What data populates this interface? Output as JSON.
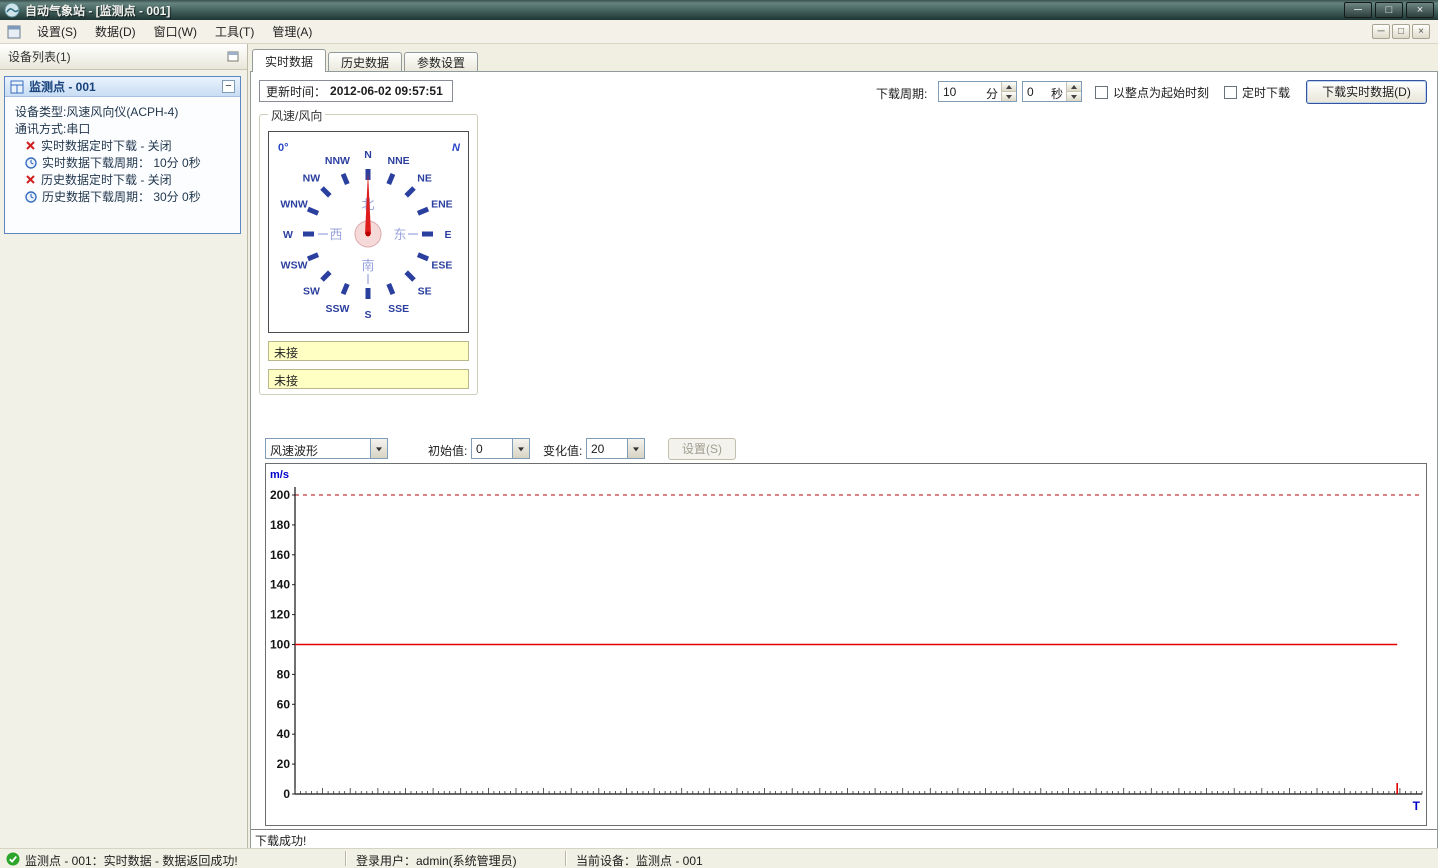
{
  "window": {
    "title": "自动气象站 - [监测点 - 001]",
    "controls": {
      "minimize": "─",
      "maximize": "□",
      "close": "×"
    }
  },
  "menu": {
    "items": [
      "设置(S)",
      "数据(D)",
      "窗口(W)",
      "工具(T)",
      "管理(A)"
    ],
    "mdi_controls": {
      "minimize": "─",
      "restore": "□",
      "close": "×"
    }
  },
  "sidebar": {
    "header": "设备列表(1)",
    "device": {
      "title": "监测点 - 001",
      "collapse_glyph": "−",
      "info_lines": [
        {
          "icon": "none",
          "text": "设备类型:风速风向仪(ACPH-4)"
        },
        {
          "icon": "none",
          "text": "通讯方式:串口"
        },
        {
          "icon": "close-red",
          "text": "实时数据定时下载 - 关闭"
        },
        {
          "icon": "clock",
          "text": "实时数据下载周期： 10分 0秒"
        },
        {
          "icon": "close-red",
          "text": "历史数据定时下载 - 关闭"
        },
        {
          "icon": "clock",
          "text": "历史数据下载周期： 30分 0秒"
        }
      ]
    }
  },
  "tabs": {
    "items": [
      "实时数据",
      "历史数据",
      "参数设置"
    ],
    "active_index": 0
  },
  "toolbar": {
    "update_label": "更新时间：",
    "update_time": "2012-06-02 09:57:51",
    "period_label": "下载周期:",
    "minutes_value": "10",
    "minutes_unit": "分",
    "seconds_value": "0",
    "seconds_unit": "秒",
    "checkbox_hour_label": "以整点为起始时刻",
    "checkbox_timed_label": "定时下载",
    "download_button": "下载实时数据(D)"
  },
  "compass": {
    "group_title": "风速/风向",
    "degree_label": "0°",
    "corner_label": "N",
    "directions": [
      "N",
      "NNE",
      "NE",
      "ENE",
      "E",
      "ESE",
      "SE",
      "SSE",
      "S",
      "SSW",
      "SW",
      "WSW",
      "W",
      "WNW",
      "NW",
      "NNW"
    ],
    "inner_labels": [
      {
        "text": "北",
        "pos": "top"
      },
      {
        "text": "东",
        "pos": "right"
      },
      {
        "text": "南",
        "pos": "bottom"
      },
      {
        "text": "西",
        "pos": "left"
      }
    ],
    "needle_bearing_deg": 0,
    "fields": [
      "未接",
      "未接"
    ]
  },
  "chart_controls": {
    "waveform_value": "风速波形",
    "initial_label": "初始值:",
    "initial_value": "0",
    "change_label": "变化值:",
    "change_value": "20",
    "settings_button": "设置(S)"
  },
  "chart_data": {
    "type": "line",
    "ylabel": "m/s",
    "xlabel": "T",
    "ylim": [
      0,
      200
    ],
    "yticks": [
      0,
      20,
      40,
      60,
      80,
      100,
      120,
      140,
      160,
      180,
      200
    ],
    "top_gridline": {
      "value": 200,
      "style": "dashed",
      "color": "#c03a3a"
    },
    "series": [
      {
        "name": "风速波形",
        "constant_value": 100,
        "color": "#e00000",
        "marker_x_fraction": 0.978
      }
    ],
    "grid": "off",
    "legend": "none"
  },
  "status": {
    "download_result": "下载成功!",
    "left": "监测点 - 001：实时数据 - 数据返回成功!",
    "user": "登录用户：admin(系统管理员)",
    "device": "当前设备：监测点 - 001"
  }
}
